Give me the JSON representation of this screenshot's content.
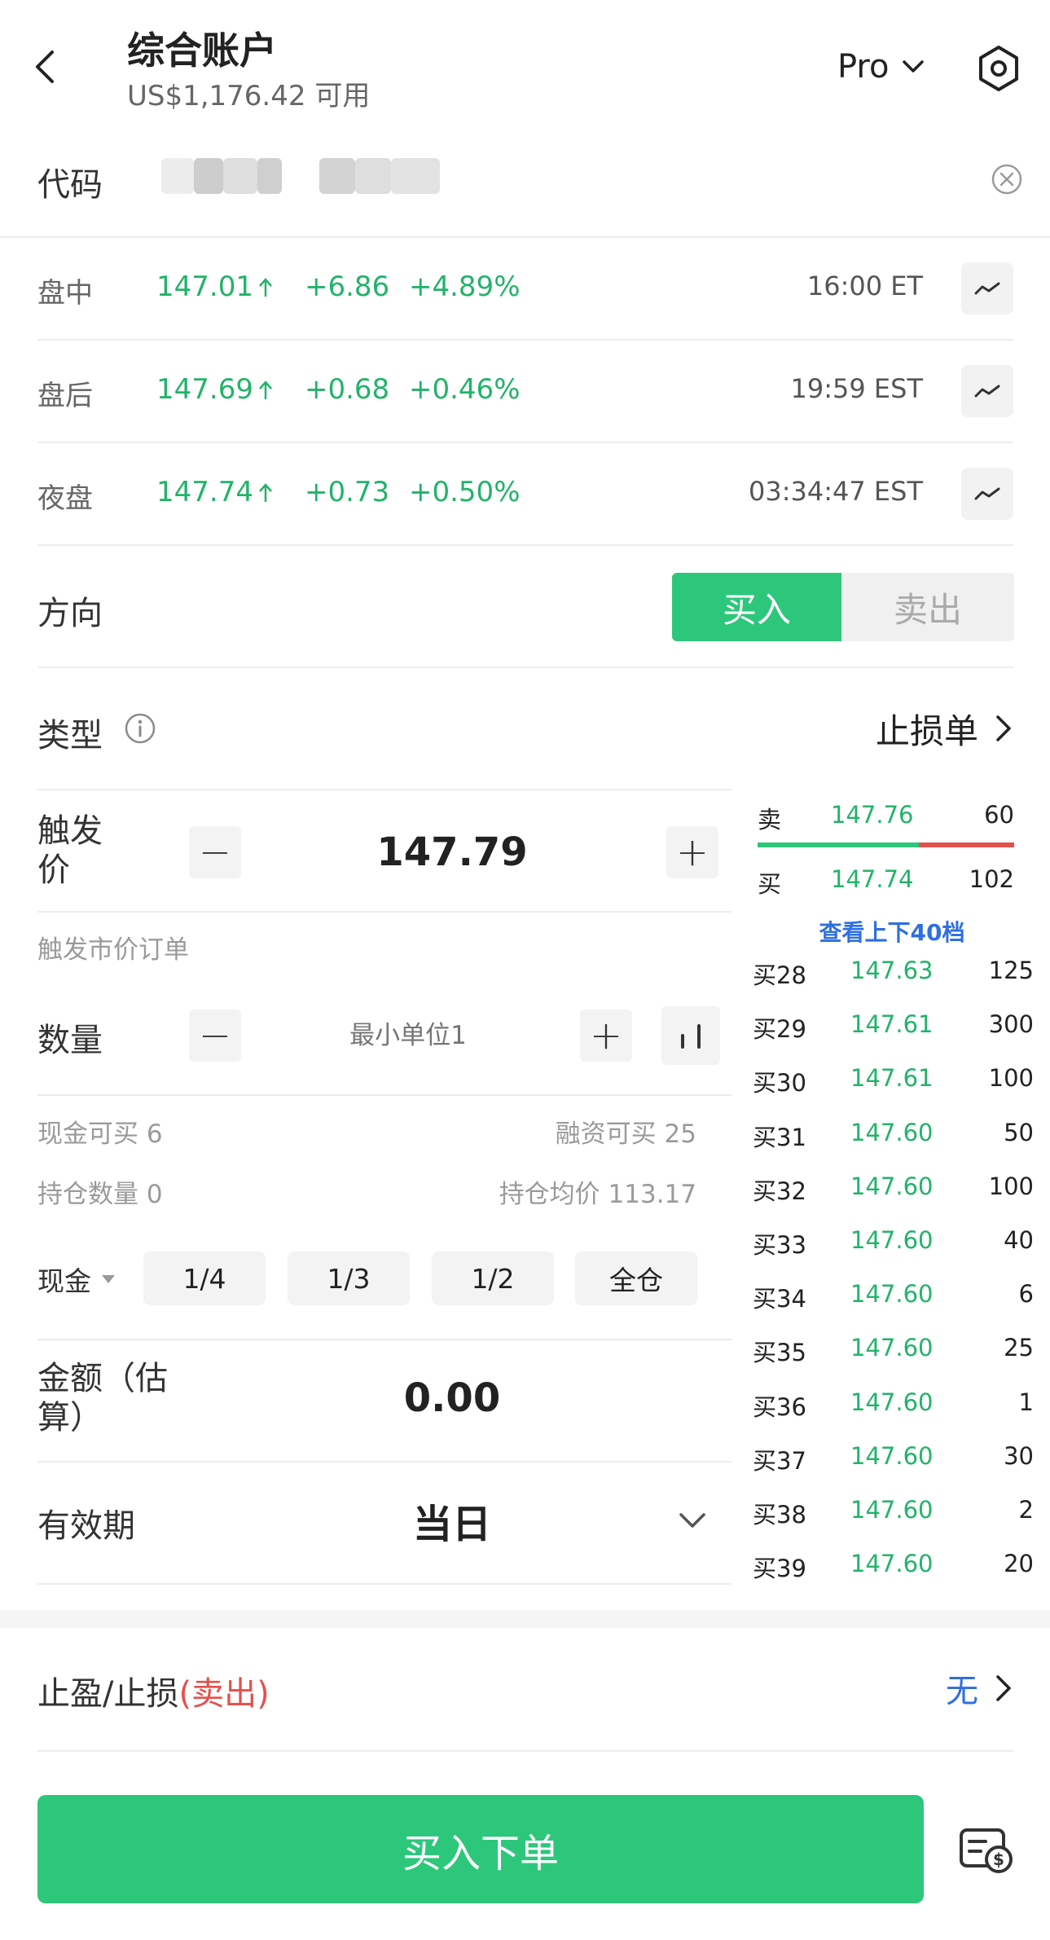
{
  "header": {
    "title": "综合账户",
    "balance": "US$1,176.42 可用",
    "mode_label": "Pro"
  },
  "symbol": {
    "label": "代码"
  },
  "quotes": [
    {
      "session": "盘中",
      "price": "147.01",
      "change": "+6.86",
      "pct": "+4.89%",
      "time": "16:00 ET"
    },
    {
      "session": "盘后",
      "price": "147.69",
      "change": "+0.68",
      "pct": "+0.46%",
      "time": "19:59 EST"
    },
    {
      "session": "夜盘",
      "price": "147.74",
      "change": "+0.73",
      "pct": "+0.50%",
      "time": "03:34:47 EST"
    }
  ],
  "direction": {
    "label": "方向",
    "buy": "买入",
    "sell": "卖出"
  },
  "order_type": {
    "label": "类型",
    "value": "止损单"
  },
  "trigger": {
    "label": "触发价",
    "value": "147.79",
    "hint": "触发市价订单"
  },
  "quantity": {
    "label": "数量",
    "placeholder": "最小单位1",
    "cash_buyable": "现金可买 6",
    "margin_buyable": "融资可买 25",
    "position_qty": "持仓数量 0",
    "position_avg": "持仓均价 113.17"
  },
  "fractions": {
    "mode": "现金",
    "options": [
      "1/4",
      "1/3",
      "1/2",
      "全仓"
    ]
  },
  "amount": {
    "label": "金额（估算）",
    "value": "0.00"
  },
  "validity": {
    "label": "有效期",
    "value": "当日"
  },
  "orderbook": {
    "ask": {
      "label": "卖",
      "price": "147.76",
      "qty": "60"
    },
    "bid": {
      "label": "买",
      "price": "147.74",
      "qty": "102"
    },
    "bid_share": 0.63,
    "more_link": "查看上下40档",
    "levels": [
      {
        "label": "买28",
        "price": "147.63",
        "qty": "125"
      },
      {
        "label": "买29",
        "price": "147.61",
        "qty": "300"
      },
      {
        "label": "买30",
        "price": "147.61",
        "qty": "100"
      },
      {
        "label": "买31",
        "price": "147.60",
        "qty": "50"
      },
      {
        "label": "买32",
        "price": "147.60",
        "qty": "100"
      },
      {
        "label": "买33",
        "price": "147.60",
        "qty": "40"
      },
      {
        "label": "买34",
        "price": "147.60",
        "qty": "6"
      },
      {
        "label": "买35",
        "price": "147.60",
        "qty": "25"
      },
      {
        "label": "买36",
        "price": "147.60",
        "qty": "1"
      },
      {
        "label": "买37",
        "price": "147.60",
        "qty": "30"
      },
      {
        "label": "买38",
        "price": "147.60",
        "qty": "2"
      },
      {
        "label": "买39",
        "price": "147.60",
        "qty": "20"
      }
    ]
  },
  "tp_sl": {
    "label_prefix": "止盈/止损",
    "label_suffix": "(卖出)",
    "value": "无"
  },
  "submit": {
    "label": "买入下单"
  },
  "colors": {
    "green": "#2dc77b",
    "red": "#e5504b",
    "blue": "#2f6fe0",
    "sell_bg": "#f0f0f0"
  }
}
